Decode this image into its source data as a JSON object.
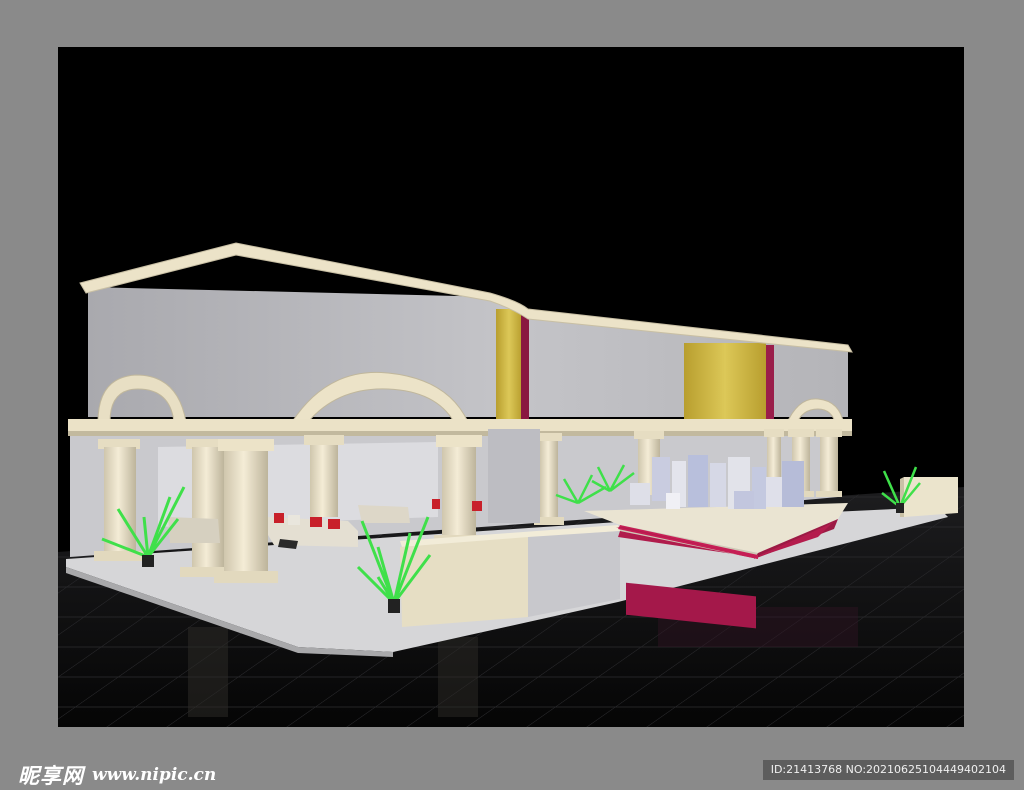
{
  "watermark": {
    "site_name_cn": "昵享网",
    "site_url": "www.nipic.cn"
  },
  "image_id_label": "ID:21413768 NO:20210625104449402104",
  "colors": {
    "frame": "#8a8a8a",
    "background": "#000000",
    "wall_gray": "#b9b9bd",
    "cream": "#e9e0c6",
    "gold_panel": "#c9b64a",
    "maroon": "#9a1e4a",
    "plant_green": "#3fe04a"
  },
  "scene": {
    "subject": "3D exhibition booth rendering",
    "elements": [
      "columns",
      "arches",
      "sofas",
      "reception-desk",
      "display-platform",
      "building-model",
      "potted-plants",
      "reflective-floor"
    ]
  }
}
